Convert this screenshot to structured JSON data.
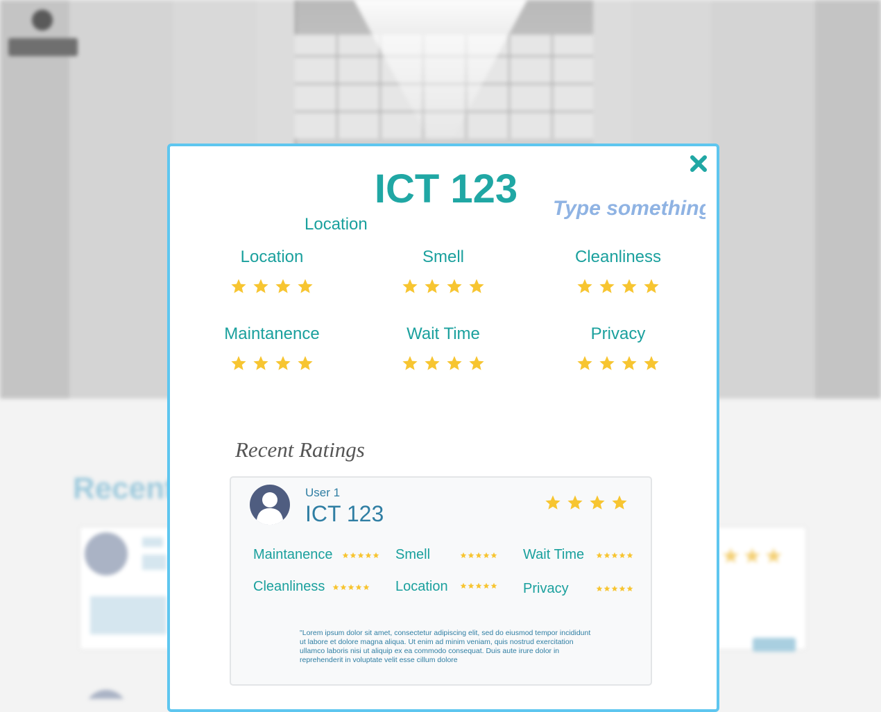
{
  "modal": {
    "title": "ICT 123",
    "subtitle": "Location",
    "note_placeholder": "Type something",
    "categories": [
      {
        "label": "Location",
        "stars": 4
      },
      {
        "label": "Smell",
        "stars": 4
      },
      {
        "label": "Cleanliness",
        "stars": 4
      },
      {
        "label": "Maintanence",
        "stars": 4
      },
      {
        "label": "Wait Time",
        "stars": 4
      },
      {
        "label": "Privacy",
        "stars": 4
      }
    ],
    "recent_heading": "Recent Ratings",
    "review": {
      "user": "User 1",
      "title": "ICT 123",
      "stars": 4,
      "mini_ratings": [
        {
          "label": "Maintanence",
          "stars": 5
        },
        {
          "label": "Smell",
          "stars": 5
        },
        {
          "label": "Wait Time",
          "stars": 5
        },
        {
          "label": "Cleanliness",
          "stars": 5
        },
        {
          "label": "Location",
          "stars": 5
        },
        {
          "label": "Privacy",
          "stars": 5
        }
      ],
      "text": "\"Lorem ipsum dolor sit amet, consectetur adipiscing elit, sed do eiusmod tempor incididunt ut labore et dolore magna aliqua. Ut enim ad minim veniam, quis nostrud exercitation ullamco laboris nisi ut aliquip ex ea commodo consequat. Duis aute irure dolor in reprehenderit in voluptate velit esse cillum dolore"
    }
  },
  "icons": {
    "close": "close-icon",
    "star": "star-icon",
    "avatar": "user-avatar-icon"
  },
  "colors": {
    "accent": "#20a7a4",
    "modal_border": "#5ec6ef",
    "star": "#f7c531",
    "placeholder": "#8fb3e3",
    "review_text": "#2f7ea3"
  }
}
